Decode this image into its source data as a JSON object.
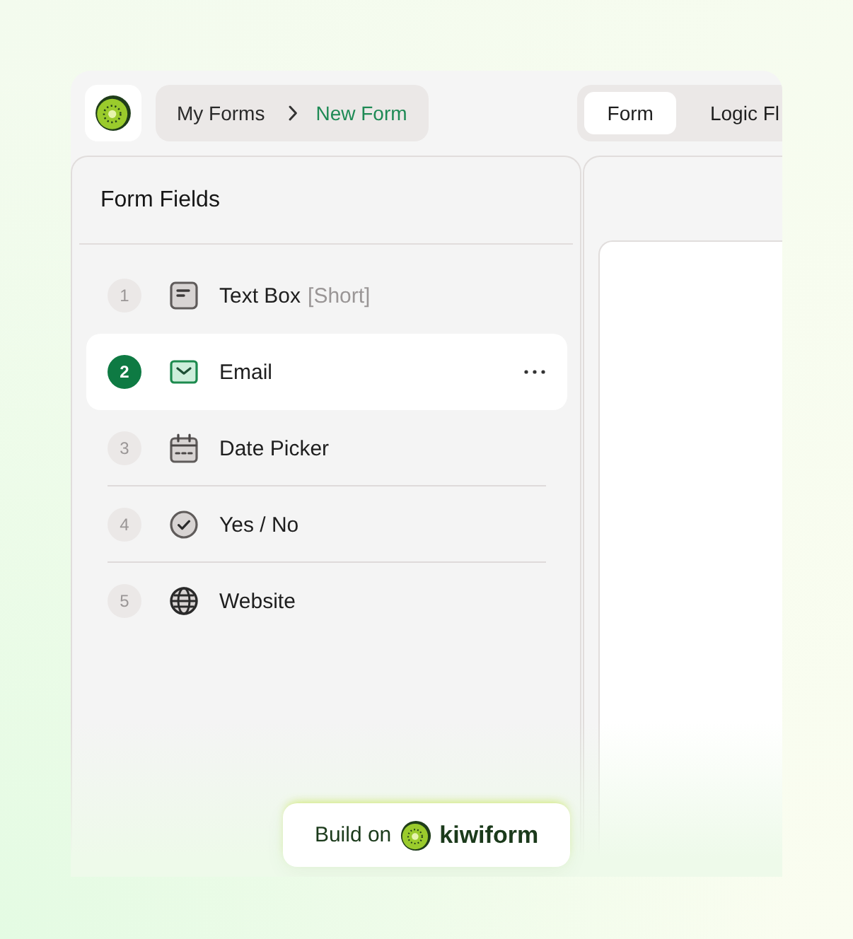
{
  "breadcrumb": [
    {
      "label": "My Forms",
      "current": false
    },
    {
      "label": "New Form",
      "current": true
    }
  ],
  "tabs": [
    {
      "label": "Form",
      "selected": true
    },
    {
      "label": "Logic Fl",
      "selected": false
    }
  ],
  "sidebar": {
    "title": "Form Fields",
    "fields": [
      {
        "number": "1",
        "kind": "text",
        "label": "Text Box",
        "note": "[Short]",
        "selected": false
      },
      {
        "number": "2",
        "kind": "email",
        "label": "Email",
        "selected": true
      },
      {
        "number": "3",
        "kind": "date",
        "label": "Date Picker",
        "selected": false
      },
      {
        "number": "4",
        "kind": "yesno",
        "label": "Yes / No",
        "selected": false
      },
      {
        "number": "5",
        "kind": "website",
        "label": "Website",
        "selected": false
      }
    ]
  },
  "branding": {
    "prefix": "Build on",
    "brand": "kiwiform"
  }
}
